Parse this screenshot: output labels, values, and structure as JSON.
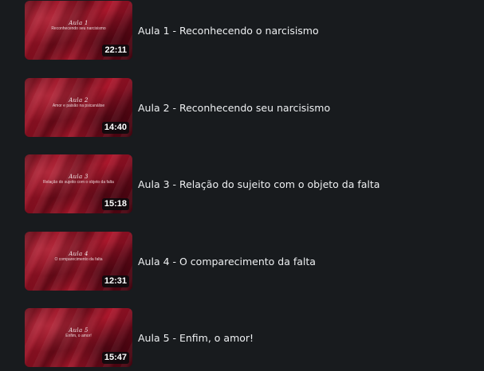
{
  "lessons": [
    {
      "thumb_title": "Aula 1",
      "thumb_subtitle": "Reconhecendo seu narcisismo",
      "duration": "22:11",
      "title": "Aula 1 - Reconhecendo o narcisismo"
    },
    {
      "thumb_title": "Aula 2",
      "thumb_subtitle": "Amor e paixão na psicanálise",
      "duration": "14:40",
      "title": "Aula 2 - Reconhecendo seu narcisismo"
    },
    {
      "thumb_title": "Aula 3",
      "thumb_subtitle": "Relação do sujeito com o objeto da falta",
      "duration": "15:18",
      "title": "Aula 3 - Relação do sujeito com o objeto da falta"
    },
    {
      "thumb_title": "Aula 4",
      "thumb_subtitle": "O comparecimento da falta",
      "duration": "12:31",
      "title": "Aula 4 - O comparecimento da falta"
    },
    {
      "thumb_title": "Aula 5",
      "thumb_subtitle": "Enfim, o amor!",
      "duration": "15:47",
      "title": "Aula 5 - Enfim, o amor!"
    }
  ]
}
